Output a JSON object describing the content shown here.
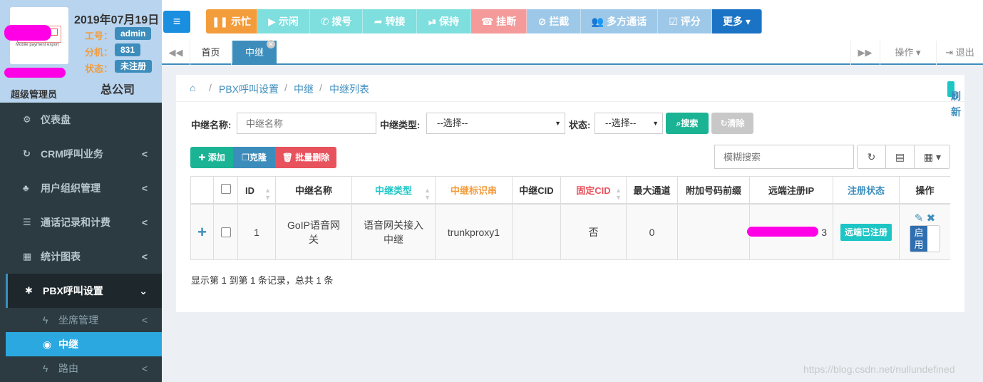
{
  "profile": {
    "date": "2019年07月19日",
    "worknum_label": "工号：",
    "worknum_value": "admin",
    "ext_label": "分机：",
    "ext_value": "831",
    "status_label": "状态：",
    "status_value": "未注册",
    "role": "超级管理员",
    "company": "总公司",
    "logo_text": "Mobile payment export"
  },
  "sidebar": {
    "items": [
      {
        "label": "仪表盘",
        "icon": "dashboard-icon",
        "glyph": "⚙"
      },
      {
        "label": "CRM呼叫业务",
        "icon": "crm-icon",
        "glyph": "↻"
      },
      {
        "label": "用户组织管理",
        "icon": "org-icon",
        "glyph": "♣"
      },
      {
        "label": "通话记录和计费",
        "icon": "list-icon",
        "glyph": "☰"
      },
      {
        "label": "统计图表",
        "icon": "table-icon",
        "glyph": "▦"
      },
      {
        "label": "PBX呼叫设置",
        "icon": "asterisk-icon",
        "glyph": "✱"
      }
    ],
    "subitems": [
      {
        "label": "坐席管理",
        "icon": "bolt-icon",
        "glyph": "ϟ"
      },
      {
        "label": "中继",
        "icon": "dot-circle-icon",
        "glyph": "◉"
      },
      {
        "label": "路由",
        "icon": "bolt-icon",
        "glyph": "ϟ"
      }
    ]
  },
  "toolbar": {
    "buttons": [
      {
        "label": "示忙",
        "glyph": "❚❚",
        "color": "#f39c3c"
      },
      {
        "label": "示闲",
        "glyph": "▶",
        "color": "#7fdede"
      },
      {
        "label": "拨号",
        "glyph": "✆",
        "color": "#7fdede"
      },
      {
        "label": "转接",
        "glyph": "➦",
        "color": "#7fdede"
      },
      {
        "label": "保持",
        "glyph": "⏯",
        "color": "#7fdede"
      },
      {
        "label": "挂断",
        "glyph": "☎",
        "color": "#f49a9a"
      },
      {
        "label": "拦截",
        "glyph": "⊘",
        "color": "#9ec8e8"
      },
      {
        "label": "多方通话",
        "glyph": "👥",
        "color": "#9ec8e8"
      },
      {
        "label": "评分",
        "glyph": "☑",
        "color": "#9ec8e8"
      },
      {
        "label": "更多",
        "glyph": "▾",
        "color": "#1a73c4"
      }
    ]
  },
  "tabs": {
    "home": "首页",
    "current": "中继",
    "ops": "操作",
    "logout": "退出"
  },
  "breadcrumb": {
    "items": [
      "PBX呼叫设置",
      "中继",
      "中继列表"
    ],
    "refresh": "刷新"
  },
  "filter": {
    "name_label": "中继名称:",
    "name_placeholder": "中继名称",
    "type_label": "中继类型:",
    "type_value": "--选择--",
    "status_label": "状态:",
    "status_value": "--选择--",
    "search": "搜索",
    "clear": "清除"
  },
  "actions": {
    "add": "添加",
    "clone": "克隆",
    "batch_delete": "批量删除",
    "fuzzy_placeholder": "模糊搜索"
  },
  "table": {
    "headers": [
      "ID",
      "中继名称",
      "中继类型",
      "中继标识串",
      "中继CID",
      "固定CID",
      "最大通道",
      "附加号码前缀",
      "远端注册IP",
      "注册状态",
      "操作"
    ],
    "row": {
      "id": "1",
      "name": "GoIP语音网关",
      "type": "语音网关接入中继",
      "identifier": "trunkproxy1",
      "cid": "",
      "fixed_cid": "否",
      "max_channels": "0",
      "prefix": "",
      "remote_ip_suffix": "3",
      "reg_status": "远端已注册",
      "toggle": "启用"
    }
  },
  "footer": {
    "info": "显示第 1 到第 1 条记录，总共 1 条"
  },
  "watermark": "https://blog.csdn.net/nullundefined"
}
